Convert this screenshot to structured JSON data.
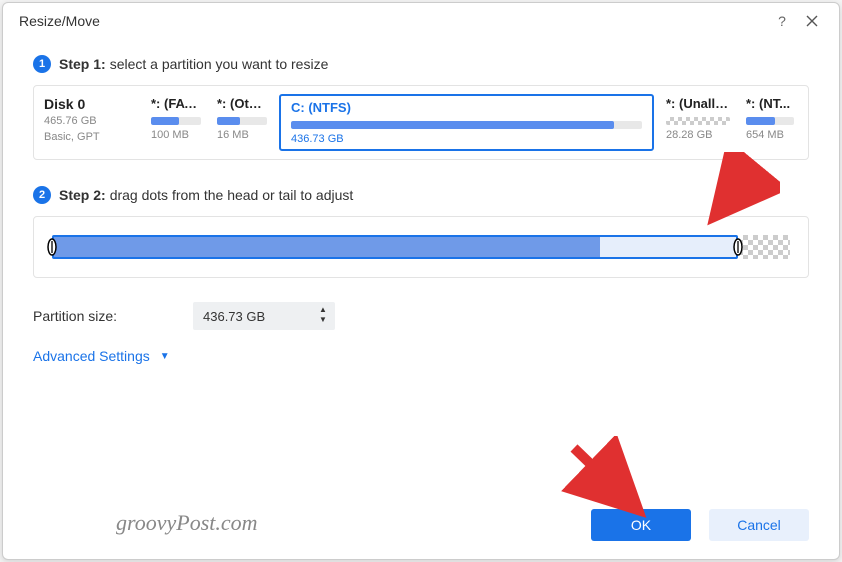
{
  "window": {
    "title": "Resize/Move"
  },
  "step1": {
    "label_prefix": "Step 1:",
    "label_text": "select a partition you want to resize",
    "disk": {
      "name": "Disk 0",
      "size": "465.76 GB",
      "type": "Basic, GPT"
    },
    "partitions": [
      {
        "name": "*: (FAT...",
        "size": "100 MB",
        "fill": 55
      },
      {
        "name": "*: (Oth...",
        "size": "16 MB",
        "fill": 45
      },
      {
        "name": "C: (NTFS)",
        "size": "436.73 GB",
        "fill": 92,
        "selected": true
      },
      {
        "name": "*: (Unallo...",
        "size": "28.28 GB",
        "unallocated": true
      },
      {
        "name": "*: (NT...",
        "size": "654 MB",
        "fill": 60
      }
    ]
  },
  "step2": {
    "label_prefix": "Step 2:",
    "label_text": "drag dots from the head or tail to adjust"
  },
  "fields": {
    "partition_size_label": "Partition size:",
    "partition_size_value": "436.73 GB"
  },
  "advanced_label": "Advanced Settings",
  "buttons": {
    "ok": "OK",
    "cancel": "Cancel"
  },
  "watermark": "groovyPost.com"
}
